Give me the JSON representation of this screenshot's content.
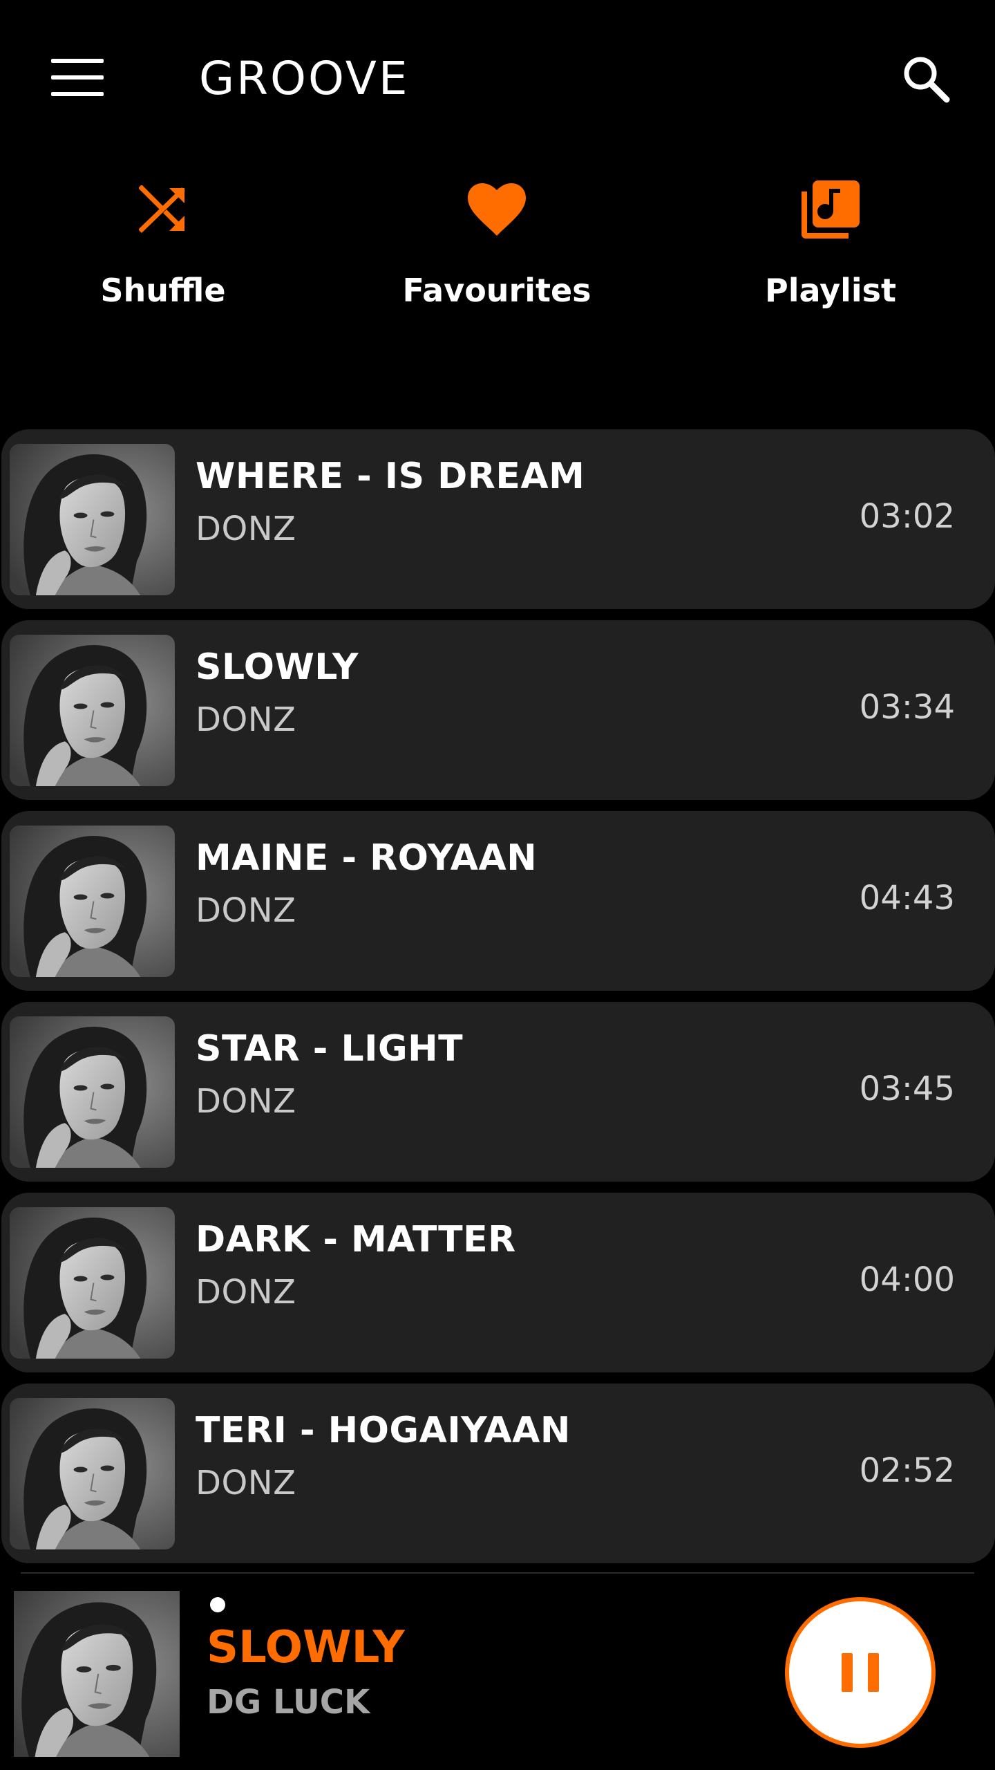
{
  "theme": {
    "accent": "#FF6D00",
    "background": "#000000",
    "card": "#212121",
    "text": "#FFFFFF",
    "secondary_text": "#C9C9C9"
  },
  "header": {
    "menu_icon": "hamburger-menu-icon",
    "title": "GROOVE",
    "search_icon": "search-icon"
  },
  "quick_actions": [
    {
      "label": "Shuffle",
      "icon": "shuffle-icon"
    },
    {
      "label": "Favourites",
      "icon": "heart-icon"
    },
    {
      "label": "Playlist",
      "icon": "music-library-icon"
    }
  ],
  "songs": [
    {
      "title": "WHERE - IS DREAM",
      "artist": "DONZ",
      "duration": "03:02",
      "art": "album-art-portrait"
    },
    {
      "title": "SLOWLY",
      "artist": "DONZ",
      "duration": "03:34",
      "art": "album-art-portrait"
    },
    {
      "title": "MAINE - ROYAAN",
      "artist": "DONZ",
      "duration": "04:43",
      "art": "album-art-portrait"
    },
    {
      "title": "STAR - LIGHT",
      "artist": "DONZ",
      "duration": "03:45",
      "art": "album-art-portrait"
    },
    {
      "title": "DARK - MATTER",
      "artist": "DONZ",
      "duration": "04:00",
      "art": "album-art-portrait"
    },
    {
      "title": "TERI - HOGAIYAAN",
      "artist": "DONZ",
      "duration": "02:52",
      "art": "album-art-portrait"
    }
  ],
  "now_playing": {
    "title": "SLOWLY",
    "artist": "DG LUCK",
    "title_color": "#FF6D00",
    "control_icon": "pause-icon"
  }
}
